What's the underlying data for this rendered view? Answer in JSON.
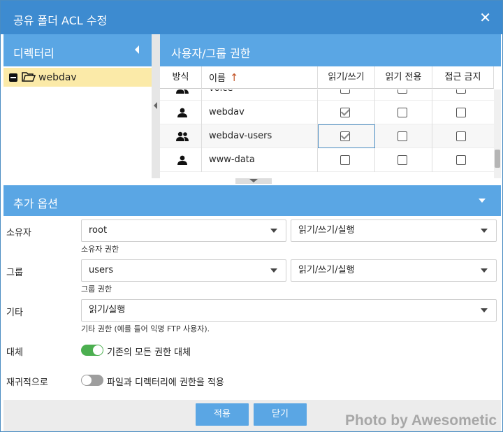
{
  "dialog": {
    "title": "공유 폴더 ACL 수정"
  },
  "directory": {
    "header": "디렉터리",
    "items": [
      {
        "name": "webdav"
      }
    ]
  },
  "acl": {
    "header": "사용자/그룹 권한",
    "columns": {
      "type": "방식",
      "name": "이름",
      "sort_icon": "↑",
      "rw": "읽기/쓰기",
      "ro": "읽기 전용",
      "deny": "접근 금지"
    },
    "rows": [
      {
        "type_icon": "users-icon",
        "name": "voice",
        "rw": false,
        "ro": false,
        "deny": false
      },
      {
        "type_icon": "user-icon",
        "name": "webdav",
        "rw": true,
        "ro": false,
        "deny": false
      },
      {
        "type_icon": "users-icon",
        "name": "webdav-users",
        "rw": true,
        "ro": false,
        "deny": false
      },
      {
        "type_icon": "user-icon",
        "name": "www-data",
        "rw": false,
        "ro": false,
        "deny": false
      }
    ]
  },
  "options": {
    "header": "추가 옵션",
    "owner": {
      "label": "소유자",
      "value": "root",
      "perm": "읽기/쓰기/실행",
      "hint": "소유자 권한"
    },
    "group": {
      "label": "그룹",
      "value": "users",
      "perm": "읽기/쓰기/실행",
      "hint": "그룹 권한"
    },
    "other": {
      "label": "기타",
      "perm": "읽기/실행",
      "hint": "기타 권한 (예를 들어 익명 FTP 사용자)."
    },
    "replace": {
      "label": "대체",
      "text": "기존의 모든 권한 대체",
      "on": true
    },
    "recursive": {
      "label": "재귀적으로",
      "text": "파일과 디렉터리에 권한을 적용",
      "on": false
    }
  },
  "buttons": {
    "apply": "적용",
    "close": "닫기"
  },
  "watermark": "Photo by Awesometic",
  "colors": {
    "title_bar": "#3d8bd0",
    "panel_header": "#5aa6e4",
    "selected_row": "#fbeaa8",
    "switch_on": "#4caf50"
  }
}
